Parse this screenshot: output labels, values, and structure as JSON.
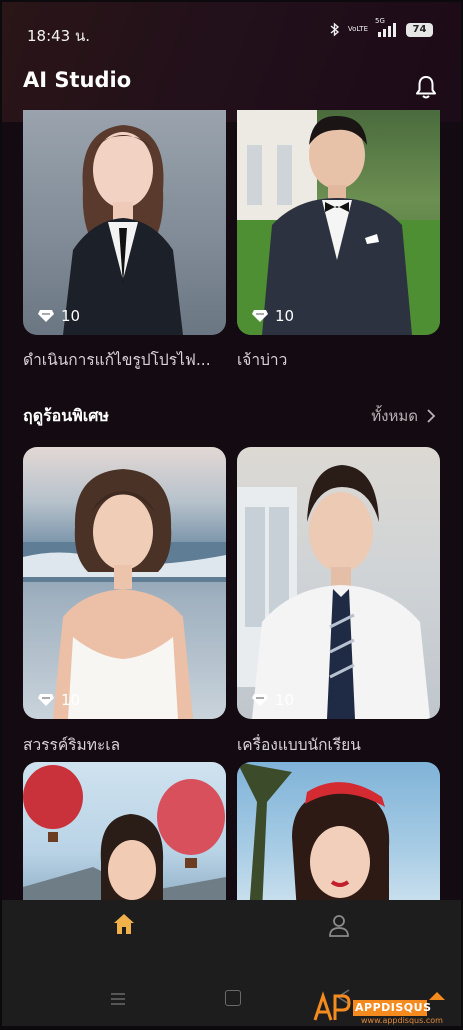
{
  "status_bar": {
    "time": "18:43 น.",
    "battery": "74",
    "network_label": "5G",
    "volte_label_top": "Vo",
    "volte_label_bottom": "LTE"
  },
  "header": {
    "title": "AI Studio"
  },
  "top_cards": [
    {
      "credits": "10",
      "title": "ดำเนินการแก้ไขรูปโปรไฟ..."
    },
    {
      "credits": "10",
      "title": "เจ้าบ่าว"
    }
  ],
  "section": {
    "title": "ฤดูร้อนพิเศษ",
    "see_all": "ทั้งหมด"
  },
  "featured_cards": [
    {
      "credits": "10",
      "title": "สวรรค์ริมทะเล"
    },
    {
      "credits": "10",
      "title": "เครื่องแบบนักเรียน"
    }
  ],
  "watermark": {
    "brand": "AP",
    "brand_full": "APPDISQUS",
    "url": "www.appdisqus.com"
  },
  "colors": {
    "background": "#140b12",
    "nav_background": "#1e1d1e",
    "active_tab": "#f0b14a",
    "watermark": "#f58a1f"
  }
}
